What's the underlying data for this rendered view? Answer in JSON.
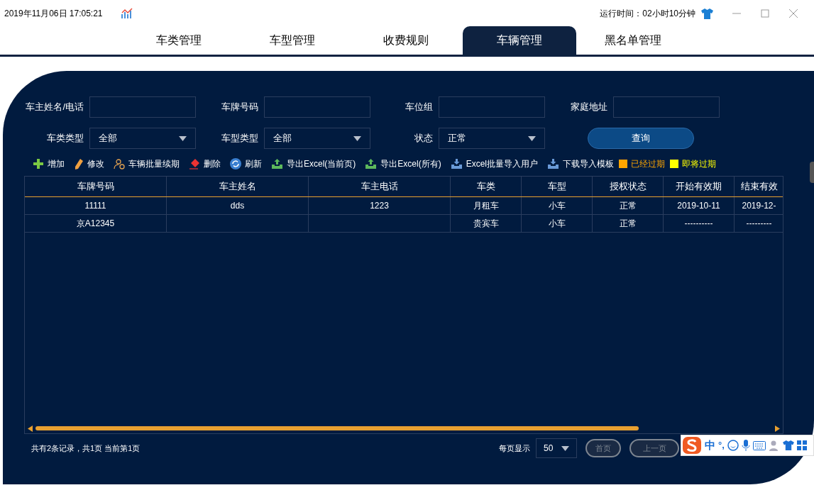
{
  "header": {
    "datetime": "2019年11月06日 17:05:21",
    "runtime": "运行时间：02小时10分钟"
  },
  "tabs": [
    {
      "label": "车类管理",
      "selected": false
    },
    {
      "label": "车型管理",
      "selected": false
    },
    {
      "label": "收费规则",
      "selected": false
    },
    {
      "label": "车辆管理",
      "selected": true
    },
    {
      "label": "黑名单管理",
      "selected": false
    }
  ],
  "filters": [
    {
      "kind": "text",
      "label": "车主姓名/电话"
    },
    {
      "kind": "text",
      "label": "车牌号码"
    },
    {
      "kind": "text",
      "label": "车位组"
    },
    {
      "kind": "text",
      "label": "家庭地址"
    },
    {
      "kind": "select",
      "label": "车类类型",
      "value": "全部"
    },
    {
      "kind": "select",
      "label": "车型类型",
      "value": "全部"
    },
    {
      "kind": "select",
      "label": "状态",
      "value": "正常"
    },
    {
      "kind": "button",
      "label": "查询"
    }
  ],
  "toolbar": [
    {
      "kind": "add",
      "label": "增加"
    },
    {
      "kind": "edit",
      "label": "修改"
    },
    {
      "kind": "renew",
      "label": "车辆批量续期"
    },
    {
      "kind": "delete",
      "label": "删除"
    },
    {
      "kind": "refresh",
      "label": "刷新"
    },
    {
      "kind": "export",
      "label": "导出Excel(当前页)"
    },
    {
      "kind": "export",
      "label": "导出Excel(所有)"
    },
    {
      "kind": "import",
      "label": "Excel批量导入用户"
    },
    {
      "kind": "import",
      "label": "下载导入模板"
    }
  ],
  "legend": [
    {
      "label": "已经过期",
      "color": "#ffa500"
    },
    {
      "label": "即将过期",
      "color": "#ffff00"
    }
  ],
  "table": {
    "columns": [
      "车牌号码",
      "车主姓名",
      "车主电话",
      "车类",
      "车型",
      "授权状态",
      "开始有效期",
      "结束有效"
    ],
    "rows": [
      [
        "11111",
        "dds",
        "1223",
        "月租车",
        "小车",
        "正常",
        "2019-10-11",
        "2019-12-"
      ],
      [
        "京A12345",
        "",
        "",
        "贵宾车",
        "小车",
        "正常",
        "----------",
        "---------"
      ]
    ]
  },
  "footer": {
    "summary": "共有2条记录，共1页 当前第1页",
    "page_size_label": "每页显示",
    "page_size": "50",
    "buttons": [
      {
        "label": "首页",
        "disabled": true
      },
      {
        "label": "上一页",
        "disabled": true
      }
    ]
  },
  "ime": {
    "mode": "中",
    "punct": "°,"
  }
}
